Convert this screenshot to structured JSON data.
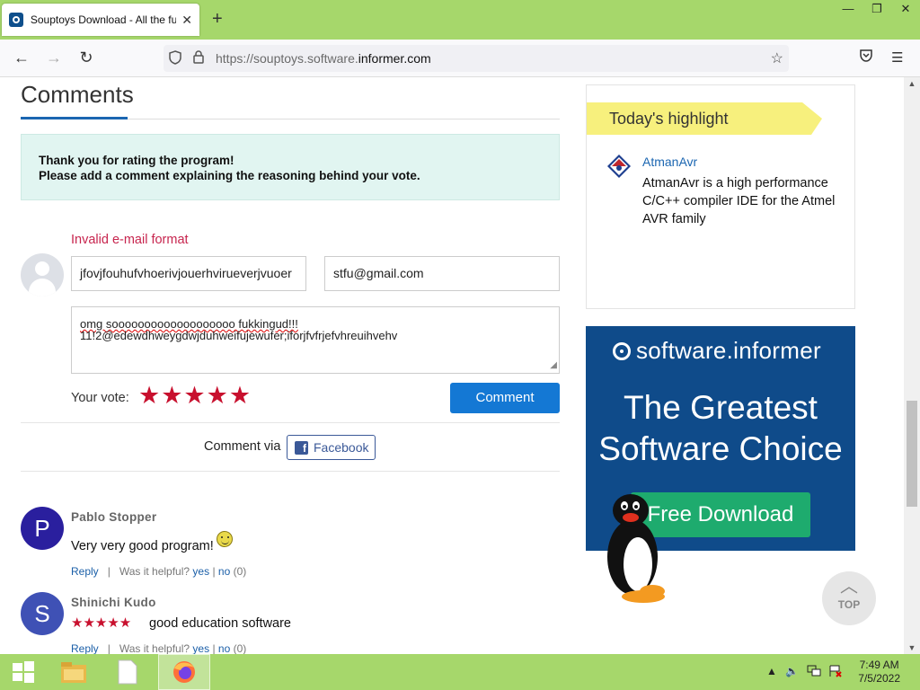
{
  "browser": {
    "tab_title": "Souptoys Download - All the fu",
    "tab_close": "✕",
    "new_tab": "+",
    "url_domain": "https://souptoys.software.",
    "url_rest": "informer.com",
    "window_controls": [
      "—",
      "❐",
      "✕"
    ]
  },
  "comments": {
    "heading": "Comments",
    "notice_line1": "Thank you for rating the program!",
    "notice_line2": "Please add a comment explaining the reasoning behind your vote.",
    "error": "Invalid e-mail format",
    "name_value": "jfovjfouhufvhoerivjouerhvirueverjvuoer",
    "email_value": "stfu@gmail.com",
    "comment_line1": "omg sooooooooooooooooooo fukkingud!!!",
    "comment_line2": "11!2@edewdhweygdwjduhweifujewufer;iforjfvfrjefvhreuihvehv",
    "vote_label": "Your vote:",
    "vote_stars": "★★★★★",
    "vote_value": 5,
    "submit_label": "Comment",
    "via_label": "Comment via",
    "facebook_label": "Facebook"
  },
  "comment_list": [
    {
      "initial": "P",
      "avatar_color": "#2a1f9e",
      "name": "Pablo Stopper",
      "text": "Very very good program!",
      "reply": "Reply",
      "helpful": "Was it helpful?",
      "yes": "yes",
      "no": "no",
      "count": "(0)"
    },
    {
      "initial": "S",
      "avatar_color": "#3f51b5",
      "name": "Shinichi Kudo",
      "stars": "★★★★★",
      "rating": 5,
      "text": "good education software",
      "reply": "Reply",
      "helpful": "Was it helpful?",
      "yes": "yes",
      "no": "no",
      "count": "(0)"
    }
  ],
  "sidebar": {
    "highlight_title": "Today's highlight",
    "app_name": "AtmanAvr",
    "app_desc": "AtmanAvr is a high performance C/C++ compiler IDE for the Atmel AVR family"
  },
  "ad": {
    "logo_text": "software.informer",
    "headline_1": "The Greatest",
    "headline_2": "Software Choice",
    "button": "Free Download"
  },
  "top_button": "TOP",
  "taskbar": {
    "time": "7:49 AM",
    "date": "7/5/2022"
  },
  "colors": {
    "accent": "#1478d4",
    "chrome_green": "#a6d76b",
    "error": "#c7254e",
    "star": "#c8102e"
  }
}
